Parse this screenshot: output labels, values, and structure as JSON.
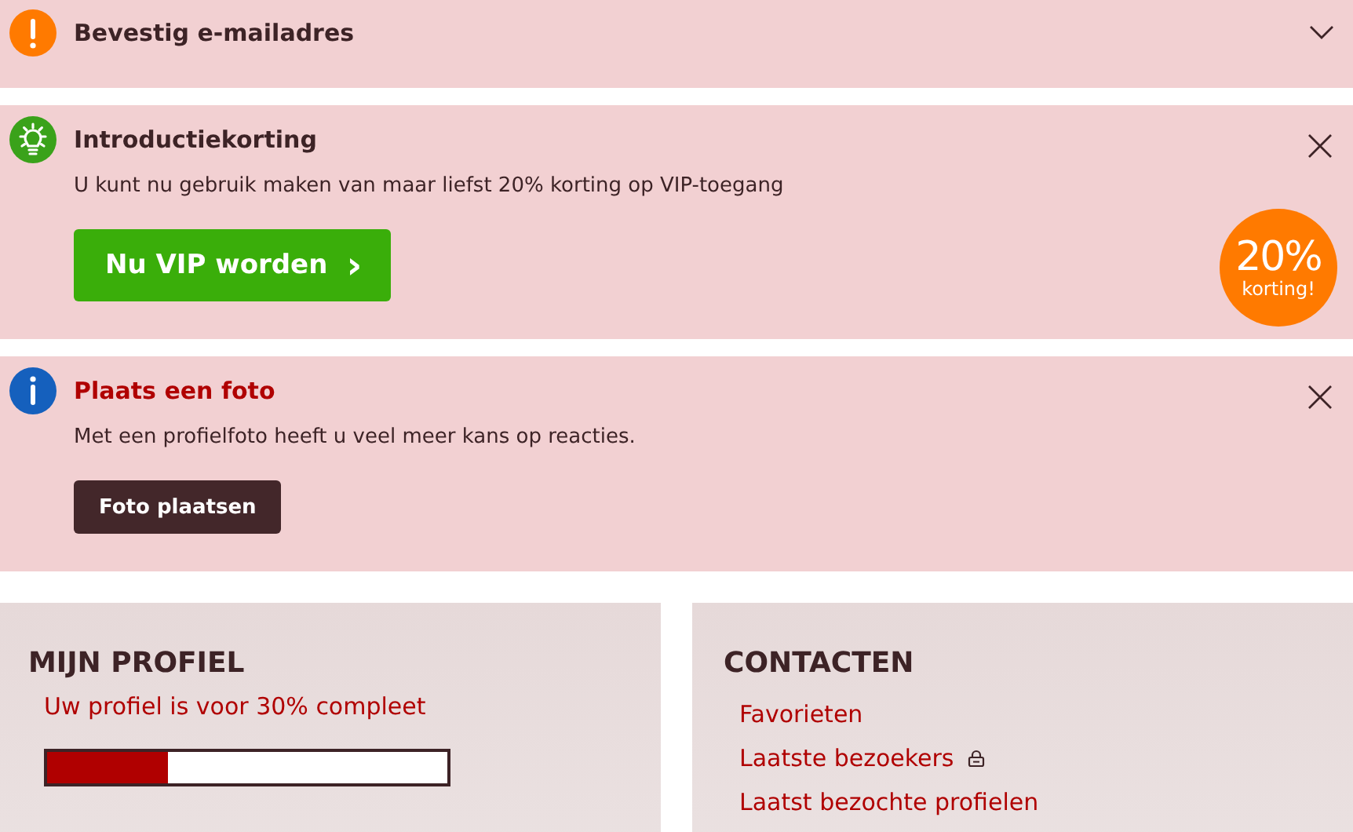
{
  "notices": [
    {
      "kind": "warning",
      "title": "Bevestig e-mailadres",
      "expanded": false
    },
    {
      "kind": "tip",
      "title": "Introductiekorting",
      "text": "U kunt nu gebruik maken van maar liefst 20% korting op VIP-toegang",
      "button": {
        "kind": "primary",
        "label": "Nu VIP worden",
        "arrow": "›"
      },
      "badge": {
        "value": "20%",
        "label": "korting!"
      }
    },
    {
      "kind": "info",
      "title": "Plaats een foto",
      "text": "Met een profielfoto heeft u veel meer kans op reacties.",
      "button": {
        "kind": "dark",
        "label": "Foto plaatsen"
      }
    }
  ],
  "profile": {
    "title": "MIJN PROFIEL",
    "status": "Uw profiel is voor 30% compleet",
    "level": 0.3
  },
  "contacts": {
    "title": "CONTACTEN",
    "links": [
      {
        "label": "Favorieten",
        "locked": false
      },
      {
        "label": "Laatste bezoekers",
        "locked": true
      },
      {
        "label": "Laatst bezochte profielen",
        "locked": false
      }
    ]
  }
}
